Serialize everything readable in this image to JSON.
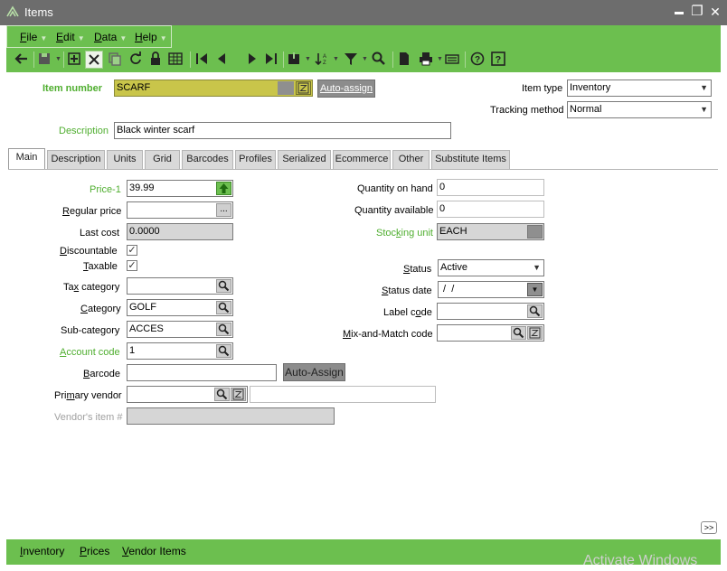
{
  "window": {
    "title": "Items",
    "minimize": "▬",
    "maximize": "❐",
    "close": "✕"
  },
  "menu": [
    {
      "label": "File",
      "mnemonic": "F",
      "rest": "ile"
    },
    {
      "label": "Edit",
      "mnemonic": "E",
      "rest": "dit"
    },
    {
      "label": "Data",
      "mnemonic": "D",
      "rest": "ata"
    },
    {
      "label": "Help",
      "mnemonic": "H",
      "rest": "elp"
    }
  ],
  "toolbar_icons": [
    "back-icon",
    "save-icon",
    "new-icon",
    "delete-icon",
    "copy-icon",
    "refresh-icon",
    "lock-icon",
    "grid-icon",
    "first-icon",
    "previous-icon",
    "next-icon",
    "last-icon",
    "bookmark-icon",
    "sort-icon",
    "filter-icon",
    "search-icon",
    "document-icon",
    "print-icon",
    "keyboard-icon",
    "help-topics-icon",
    "whats-this-icon"
  ],
  "header": {
    "item_number_label": "Item number",
    "item_number_value": "SCARF",
    "auto_assign": "Auto-assign",
    "description_label": "Description",
    "description_value": "Black winter scarf",
    "item_type_label": "Item type",
    "item_type_value": "Inventory",
    "tracking_method_label": "Tracking method",
    "tracking_method_value": "Normal"
  },
  "tabs": [
    "Main",
    "Description",
    "Units",
    "Grid",
    "Barcodes",
    "Profiles",
    "Serialized",
    "Ecommerce",
    "Other",
    "Substitute Items"
  ],
  "active_tab": "Main",
  "main_left": {
    "price1_label": "Price-1",
    "price1_value": "39.99",
    "regular_price_label": "Regular price",
    "regular_price_value": "",
    "regular_price_btn": "...",
    "last_cost_label": "Last cost",
    "last_cost_value": "0.0000",
    "discountable_label": "Discountable",
    "discountable_checked": "✓",
    "taxable_label": "Taxable",
    "taxable_checked": "✓",
    "tax_category_label": "Tax category",
    "tax_category_value": "",
    "category_label": "Category",
    "category_value": "GOLF",
    "subcategory_label": "Sub-category",
    "subcategory_value": "ACCES",
    "account_code_label": "Account code",
    "account_code_value": "1",
    "barcode_label": "Barcode",
    "barcode_value": "",
    "barcode_auto_assign": "Auto-Assign",
    "primary_vendor_label": "Primary vendor",
    "primary_vendor_value": "",
    "primary_vendor_name": "",
    "vendors_item_label": "Vendor's item #",
    "vendors_item_value": ""
  },
  "main_right": {
    "qty_on_hand_label": "Quantity on hand",
    "qty_on_hand_value": "0",
    "qty_available_label": "Quantity available",
    "qty_available_value": "0",
    "stocking_unit_label": "Stocking unit",
    "stocking_unit_value": "EACH",
    "status_label": "Status",
    "status_value": "Active",
    "status_date_label": "Status date",
    "status_date_value": " /  /",
    "label_code_label": "Label code",
    "label_code_value": "",
    "mix_match_label": "Mix-and-Match code",
    "mix_match_value": ""
  },
  "scroll_btn": ">>",
  "bottom": [
    {
      "label": "Inventory"
    },
    {
      "label": "Prices"
    },
    {
      "label": "Vendor Items"
    }
  ],
  "watermark": "Activate Windows",
  "colors": {
    "accent_green": "#6cbf4f",
    "label_green": "#4fae2f",
    "titlebar": "#6d6d6d",
    "item_number_field": "#c9c54a"
  }
}
